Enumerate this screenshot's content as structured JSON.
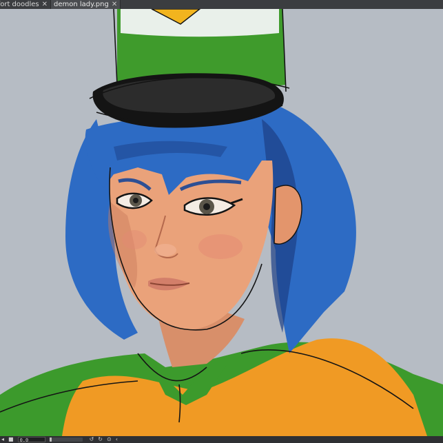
{
  "tabs": [
    {
      "label": "fort doodles",
      "active": false,
      "close": "✕"
    },
    {
      "label": "demon lady.png",
      "active": true,
      "close": "✕"
    }
  ],
  "canvas": {
    "background": "#b6bcc4",
    "palette": {
      "hat_green": "#3f9b2c",
      "hat_band": "#e9f0ea",
      "badge_yellow": "#f2b41e",
      "hair_blue": "#2d6bc4",
      "hair_dark": "#1c3f86",
      "skin": "#eaa27a",
      "skin_shadow": "#c97a5a",
      "blush": "#e38a73",
      "coat_orange": "#f09a24",
      "coat_green": "#3c9a2c",
      "lineart": "#141414"
    }
  },
  "statusbar": {
    "field_value": "0.0",
    "icons": [
      "rotate-left-icon",
      "rotate-right-icon",
      "reset-icon",
      "mirror-icon"
    ]
  }
}
